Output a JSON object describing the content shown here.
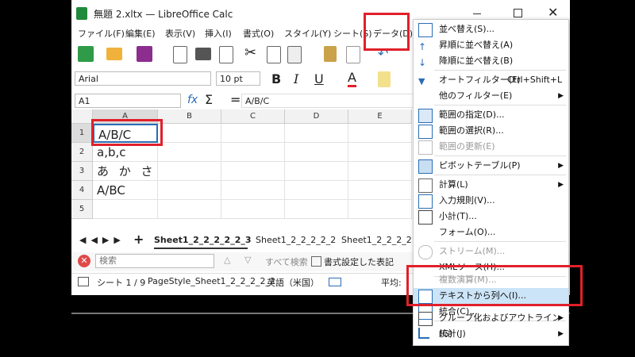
{
  "window": {
    "title": "無題 2.xltx — LibreOffice Calc"
  },
  "menubar": [
    "ファイル(F)",
    "編集(E)",
    "表示(V)",
    "挿入(I)",
    "書式(O)",
    "スタイル(Y)",
    "シート(S)",
    "データ(D)"
  ],
  "format": {
    "font": "Arial",
    "size": "10 pt"
  },
  "formula": {
    "cell_ref": "A1",
    "content": "A/B/C"
  },
  "columns": [
    "A",
    "B",
    "C",
    "D",
    "E"
  ],
  "rows": [
    {
      "num": "1",
      "a": "A/B/C"
    },
    {
      "num": "2",
      "a": "a,b,c"
    },
    {
      "num": "3",
      "a": "あ か さ"
    },
    {
      "num": "4",
      "a": "A/BC"
    },
    {
      "num": "5",
      "a": ""
    }
  ],
  "tabs": [
    "Sheet1_2_2_2_2_2_3",
    "Sheet1_2_2_2_2_2",
    "Sheet1_2_2_2_2"
  ],
  "find": {
    "placeholder": "検索",
    "search_all": "すべて検索",
    "formatted": "書式設定した表記"
  },
  "status": {
    "sheet": "シート 1 / 9",
    "page_style": "PageStyle_Sheet1_2_2_2_2_2",
    "lang": "英語（米国）",
    "avg": "平均:"
  },
  "data_menu": {
    "items": [
      {
        "label": "並べ替え(S)...",
        "icon": "sort-icon",
        "disabled": false,
        "submenu": false
      },
      {
        "label": "昇順に並べ替え(A)",
        "icon": "sort-asc-icon",
        "disabled": false,
        "submenu": false
      },
      {
        "label": "降順に並べ替え(B)",
        "icon": "sort-desc-icon",
        "disabled": false,
        "submenu": false
      },
      {
        "label": "オートフィルター(F)",
        "shortcut": "Ctrl+Shift+L",
        "icon": "autofilter-icon",
        "disabled": false,
        "submenu": false
      },
      {
        "label": "他のフィルター(E)",
        "icon": "",
        "disabled": false,
        "submenu": true
      },
      {
        "label": "範囲の指定(D)...",
        "icon": "define-range-icon",
        "disabled": false,
        "submenu": false
      },
      {
        "label": "範囲の選択(R)...",
        "icon": "select-range-icon",
        "disabled": false,
        "submenu": false
      },
      {
        "label": "範囲の更新(E)",
        "icon": "refresh-range-icon",
        "disabled": true,
        "submenu": false
      },
      {
        "label": "ピボットテーブル(P)",
        "icon": "pivot-icon",
        "disabled": false,
        "submenu": true
      },
      {
        "label": "計算(L)",
        "icon": "calculate-icon",
        "disabled": false,
        "submenu": true
      },
      {
        "label": "入力規則(V)...",
        "icon": "validity-icon",
        "disabled": false,
        "submenu": false
      },
      {
        "label": "小計(T)...",
        "icon": "subtotal-icon",
        "disabled": false,
        "submenu": false
      },
      {
        "label": "フォーム(O)...",
        "icon": "",
        "disabled": false,
        "submenu": false
      },
      {
        "label": "ストリーム(M)...",
        "icon": "stream-icon",
        "disabled": true,
        "submenu": false
      },
      {
        "label": "XMLソース(H)...",
        "icon": "",
        "disabled": false,
        "submenu": false
      },
      {
        "label": "複数演算(M)...",
        "icon": "",
        "disabled": true,
        "submenu": false
      },
      {
        "label": "テキストから列へ(I)...",
        "icon": "text-to-columns-icon",
        "disabled": false,
        "submenu": false
      },
      {
        "label": "統合(C)...",
        "icon": "consolidate-icon",
        "disabled": false,
        "submenu": false
      },
      {
        "label": "グループ化およびアウトライン(G)",
        "icon": "group-icon",
        "disabled": false,
        "submenu": true
      },
      {
        "label": "統計(J)",
        "icon": "statistics-icon",
        "disabled": false,
        "submenu": true
      }
    ]
  },
  "colors": {
    "accent": "#1f8a3b",
    "highlight": "#cce4f7",
    "red_box": "#e0202a"
  }
}
